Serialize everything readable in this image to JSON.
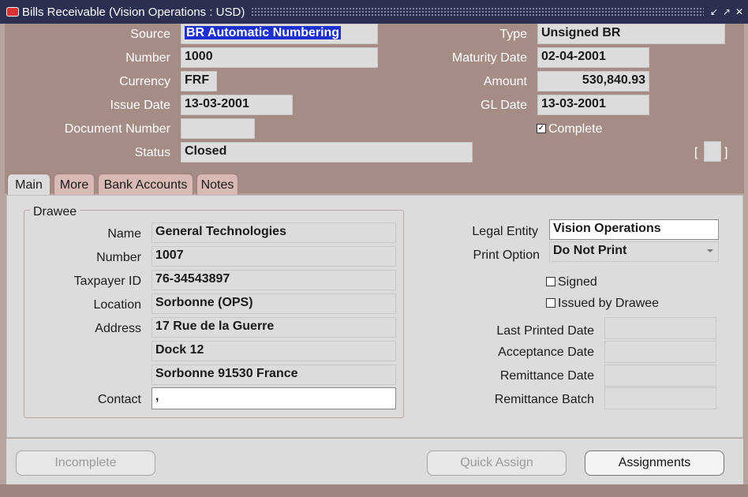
{
  "window": {
    "title": "Bills Receivable (Vision Operations : USD)"
  },
  "header": {
    "source_label": "Source",
    "source_value": "BR Automatic Numbering",
    "type_label": "Type",
    "type_value": "Unsigned BR",
    "number_label": "Number",
    "number_value": "1000",
    "maturity_label": "Maturity Date",
    "maturity_value": "02-04-2001",
    "currency_label": "Currency",
    "currency_value": "FRF",
    "amount_label": "Amount",
    "amount_value": "530,840.93",
    "issue_label": "Issue Date",
    "issue_value": "13-03-2001",
    "gl_label": "GL Date",
    "gl_value": "13-03-2001",
    "docnum_label": "Document Number",
    "docnum_value": "",
    "complete_label": "Complete",
    "complete_checked": true,
    "status_label": "Status",
    "status_value": "Closed",
    "bracket_left": "[",
    "bracket_right": "]"
  },
  "tabs": [
    {
      "label": "Main",
      "active": true
    },
    {
      "label": "More",
      "active": false
    },
    {
      "label": "Bank Accounts",
      "active": false
    },
    {
      "label": "Notes",
      "active": false
    }
  ],
  "drawee": {
    "group_title": "Drawee",
    "name_label": "Name",
    "name_value": "General Technologies",
    "number_label": "Number",
    "number_value": "1007",
    "taxpayer_label": "Taxpayer ID",
    "taxpayer_value": "76-34543897",
    "location_label": "Location",
    "location_value": "Sorbonne (OPS)",
    "address_label": "Address",
    "address_line1": "17 Rue de la Guerre",
    "address_line2": "Dock 12",
    "address_line3": "Sorbonne 91530 France",
    "contact_label": "Contact",
    "contact_value": ","
  },
  "right": {
    "legal_label": "Legal Entity",
    "legal_value": "Vision Operations",
    "print_label": "Print Option",
    "print_value": "Do Not Print",
    "signed_label": "Signed",
    "signed_checked": false,
    "issued_label": "Issued by Drawee",
    "issued_checked": false,
    "last_printed_label": "Last Printed Date",
    "last_printed_value": "",
    "acceptance_label": "Acceptance Date",
    "acceptance_value": "",
    "remit_date_label": "Remittance Date",
    "remit_date_value": "",
    "remit_batch_label": "Remittance Batch",
    "remit_batch_value": ""
  },
  "buttons": {
    "incomplete": "Incomplete",
    "quick_assign": "Quick Assign",
    "assignments": "Assignments"
  },
  "colors": {
    "title_bar": "#2c2f52",
    "header_bg": "#a58d86",
    "panel_bg": "#dcdcdc",
    "selection": "#1c2fcf"
  }
}
